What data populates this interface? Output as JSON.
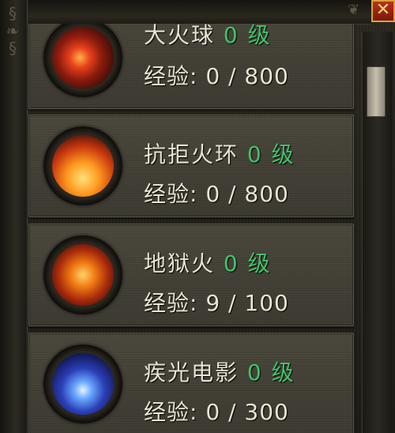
{
  "window": {
    "close_label": "✕"
  },
  "skills": [
    {
      "name": "大火球",
      "level": "0",
      "level_unit": "级",
      "exp_label": "经验: 0 / 800",
      "icon": "fireball-icon"
    },
    {
      "name": "抗拒火环",
      "level": "0",
      "level_unit": "级",
      "exp_label": "经验: 0 / 800",
      "icon": "fire-ring-icon"
    },
    {
      "name": "地狱火",
      "level": "0",
      "level_unit": "级",
      "exp_label": "经验: 9 / 100",
      "icon": "hellfire-icon"
    },
    {
      "name": "疾光电影",
      "level": "0",
      "level_unit": "级",
      "exp_label": "经验: 0 / 300",
      "icon": "lightning-icon"
    }
  ],
  "scrollbar": {
    "position": 0.1
  },
  "colors": {
    "level_green": "#3ec46a",
    "text": "#e8e3d2",
    "close_red": "#b8321a"
  }
}
